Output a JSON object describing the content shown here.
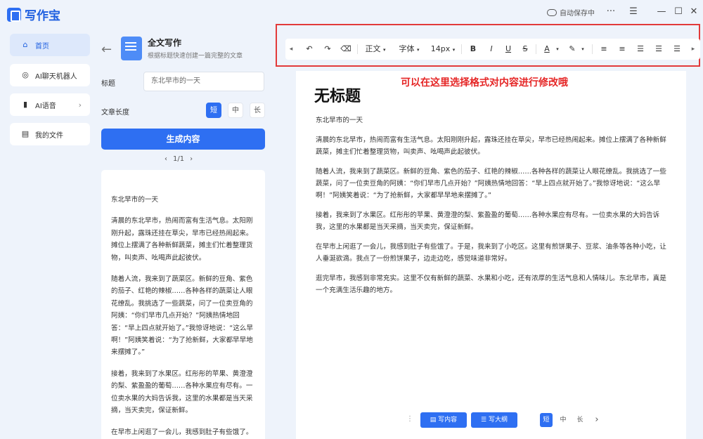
{
  "app": {
    "name": "写作宝",
    "autosave": "自动保存中"
  },
  "window": {
    "more": "···",
    "menu": "☰",
    "minimize": "—",
    "maximize": "☐",
    "close": "✕"
  },
  "nav": {
    "items": [
      {
        "label": "首页",
        "icon": "home-icon"
      },
      {
        "label": "AI聊天机器人",
        "icon": "chat-icon"
      },
      {
        "label": "AI语音",
        "icon": "voice-icon"
      },
      {
        "label": "我的文件",
        "icon": "file-icon"
      }
    ]
  },
  "feature": {
    "title": "全文写作",
    "subtitle": "根据标题快速创建一篇完整的文章"
  },
  "form": {
    "title_label": "标题",
    "title_value": "东北早市的一天",
    "length_label": "文章长度",
    "length_options": [
      "短",
      "中",
      "长"
    ],
    "generate": "生成内容",
    "pager": "1/1"
  },
  "result": {
    "paragraphs": [
      "东北早市的一天",
      "清晨的东北早市，热闹而富有生活气息。太阳刚刚升起，露珠还挂在草尖，早市已经热闹起来。摊位上摆满了各种新鲜蔬菜，摊主们忙着整理货物，叫卖声、吆喝声此起彼伏。",
      "随着人流，我来到了蔬菜区。新鲜的豆角、紫色的茄子、红艳的辣椒……各种各样的蔬菜让人眼花缭乱。我挑选了一些蔬菜，问了一位卖豆角的阿姨：“你们早市几点开始？”阿姨热情地回答：“早上四点就开始了。”我惊讶地说：“这么早啊！”阿姨笑着说：“为了抢新鲜，大家都早早地来摆摊了。”",
      "接着，我来到了水果区。红彤彤的苹果、黄澄澄的梨、紫盈盈的葡萄……各种水果应有尽有。一位卖水果的大妈告诉我，这里的水果都是当天采摘，当天卖完，保证新鲜。",
      "在早市上闲逛了一会儿，我感到肚子有些饿了。于是，我来到了小吃区。这里有煎饼果子"
    ]
  },
  "toolbar": {
    "undo": "↶",
    "redo": "↷",
    "clear": "⌫",
    "paragraph": "正文",
    "font": "字体",
    "size": "14px",
    "bold": "B",
    "italic": "I",
    "underline": "U",
    "strike": "S",
    "font_color": "A",
    "highlight": "✎",
    "scroll_left": "◂",
    "scroll_right": "▸"
  },
  "annotation": "可以在这里选择格式对内容进行修改哦",
  "editor": {
    "title": "无标题",
    "paragraphs": [
      "东北早市的一天",
      "清晨的东北早市，热闹而富有生活气息。太阳刚刚升起，露珠还挂在草尖，早市已经热闹起来。摊位上摆满了各种新鲜蔬菜，摊主们忙着整理货物，叫卖声、吆喝声此起彼伏。",
      "随着人流，我来到了蔬菜区。新鲜的豆角、紫色的茄子、红艳的辣椒……各种各样的蔬菜让人眼花缭乱。我挑选了一些蔬菜，问了一位卖豆角的阿姨：“你们早市几点开始？”阿姨热情地回答：“早上四点就开始了。”我惊讶地说：“这么早啊！”阿姨笑着说：“为了抢新鲜，大家都早早地来摆摊了。”",
      "接着，我来到了水果区。红彤彤的苹果、黄澄澄的梨、紫盈盈的葡萄……各种水果应有尽有。一位卖水果的大妈告诉我，这里的水果都是当天采摘，当天卖完，保证新鲜。",
      "在早市上闲逛了一会儿，我感到肚子有些饿了。于是，我来到了小吃区。这里有煎饼果子、豆浆、油条等各种小吃，让人垂涎欲滴。我点了一份煎饼果子，边走边吃，感觉味道非常好。",
      "逛完早市，我感到非常充实。这里不仅有新鲜的蔬菜、水果和小吃，还有浓厚的生活气息和人情味儿。东北早市，真是一个充满生活乐趣的地方。"
    ]
  },
  "bottom_bar": {
    "write_content": "写内容",
    "write_outline": "写大纲",
    "length_options": [
      "短",
      "中",
      "长"
    ],
    "next": "›"
  },
  "colors": {
    "accent": "#2e6ff2",
    "annotation": "#e52626"
  }
}
